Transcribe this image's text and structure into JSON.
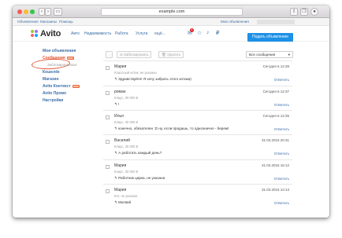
{
  "browser": {
    "url": "example.com"
  },
  "topnav": {
    "items": [
      "Объявления",
      "Магазины",
      "Помощь"
    ],
    "my_ads": "Мои объявления"
  },
  "header": {
    "logo": "Avito",
    "nav": [
      "Авто",
      "Недвижимость",
      "Работа",
      "Услуги",
      "ещё..."
    ],
    "badge": "4",
    "post_button": "Подать объявление"
  },
  "sidebar": {
    "items": [
      {
        "label": "Мои объявления"
      },
      {
        "label": "Сообщения",
        "tag": "new"
      },
      {
        "label": "Заблокированные"
      },
      {
        "label": "Кошелёк"
      },
      {
        "label": "Магазин"
      },
      {
        "label": "Avito Контекст",
        "tag": "new"
      },
      {
        "label": "Avito Промо"
      },
      {
        "label": "Настройки"
      }
    ]
  },
  "toolbar": {
    "block": "Заблокировать",
    "delete": "Удалить",
    "filter": "Все сообщения"
  },
  "messages": [
    {
      "name": "Мария",
      "ad": "Классный котик, не указана",
      "text": "Здравствуйте! Я хочу забрать этого котика)",
      "date": "Сегодня в 12:38",
      "reply": "Ответить"
    },
    {
      "name": "роман",
      "ad": "Клаус, 30 000 ₽",
      "text": "!",
      "date": "Сегодня в 12:37",
      "reply": "Ответить"
    },
    {
      "name": "Илья",
      "ad": "Клаус, 30 000 ₽",
      "text": "конечно, обязателен :D ну, если продашь, то однозначно - берем!",
      "date": "Сегодня в 12:35",
      "reply": "Ответить"
    },
    {
      "name": "Василий",
      "ad": "Клаус, 30 000 ₽",
      "text": "А работать каждый день?",
      "date": "31.03.2016 20:31",
      "reply": "Ответить"
    },
    {
      "name": "Мария",
      "ad": "Клаус, 30 000 ₽",
      "text": "Работник цирка, не указана",
      "date": "31.03.2016 16:12",
      "reply": "Ответить"
    },
    {
      "name": "Мария",
      "ad": "Кот, не указана",
      "text": "Матвей",
      "date": "31.03.2016 14:13",
      "reply": "Ответить"
    }
  ]
}
